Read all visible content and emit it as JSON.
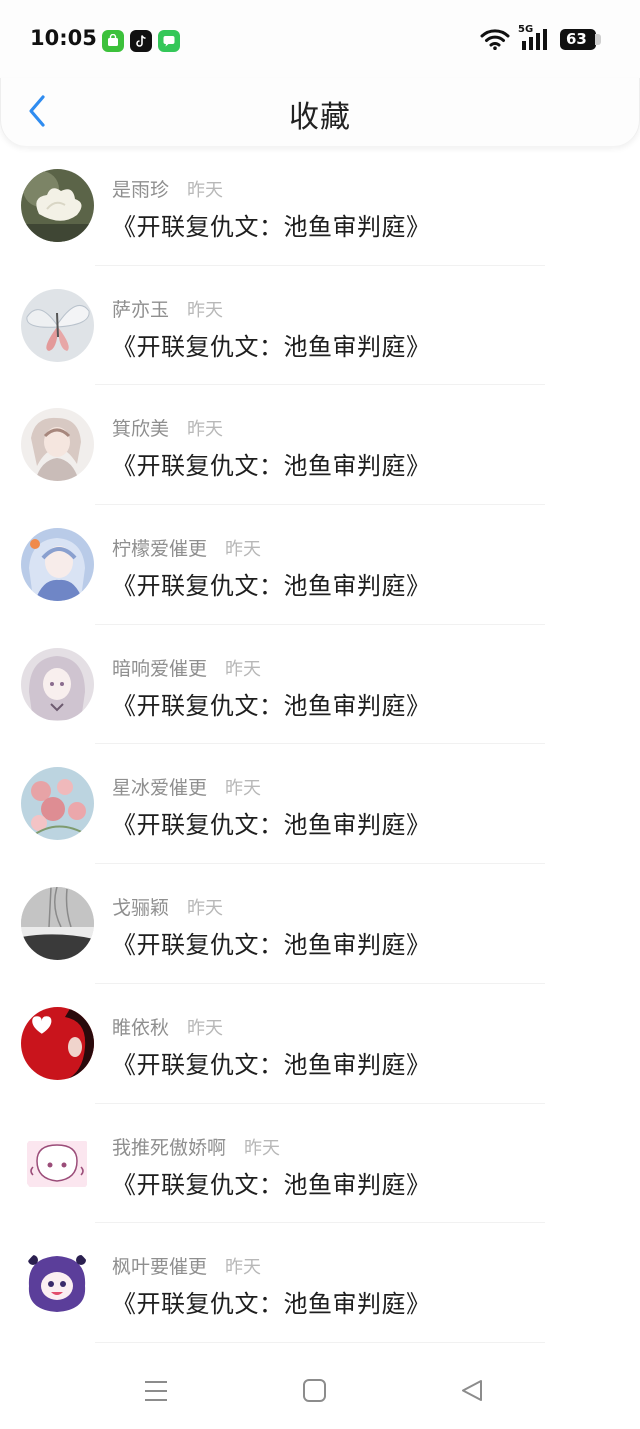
{
  "status": {
    "time": "10:05",
    "network": "5G",
    "battery": "63",
    "app_icons": [
      "shop-app-icon",
      "tiktok-icon",
      "messages-icon"
    ]
  },
  "header": {
    "title": "收藏",
    "back_icon": "chevron-left-icon",
    "accent": "#2f8cf0"
  },
  "items": [
    {
      "name": "是雨珍",
      "time": "昨天",
      "text": "《开联复仇文：池鱼审判庭》",
      "avatar": "white-lotus"
    },
    {
      "name": "萨亦玉",
      "time": "昨天",
      "text": "《开联复仇文：池鱼审判庭》",
      "avatar": "butterfly"
    },
    {
      "name": "箕欣美",
      "time": "昨天",
      "text": "《开联复仇文：池鱼审判庭》",
      "avatar": "anime-boy"
    },
    {
      "name": "柠檬爱催更",
      "time": "昨天",
      "text": "《开联复仇文：池鱼审判庭》",
      "avatar": "anime-girl-blue"
    },
    {
      "name": "暗响爱催更",
      "time": "昨天",
      "text": "《开联复仇文：池鱼审判庭》",
      "avatar": "anime-girl-pale"
    },
    {
      "name": "星冰爱催更",
      "time": "昨天",
      "text": "《开联复仇文：池鱼审判庭》",
      "avatar": "pink-flowers"
    },
    {
      "name": "戈骊颖",
      "time": "昨天",
      "text": "《开联复仇文：池鱼审判庭》",
      "avatar": "winter-willow"
    },
    {
      "name": "睢依秋",
      "time": "昨天",
      "text": "《开联复仇文：池鱼审判庭》",
      "avatar": "red-heart"
    },
    {
      "name": "我推死傲娇啊",
      "time": "昨天",
      "text": "《开联复仇文：池鱼审判庭》",
      "avatar": "chibi-sketch"
    },
    {
      "name": "枫叶要催更",
      "time": "昨天",
      "text": "《开联复仇文：池鱼审判庭》",
      "avatar": "purple-chibi"
    }
  ],
  "bottom_nav": [
    "menu-icon",
    "home-square-icon",
    "back-triangle-icon"
  ]
}
